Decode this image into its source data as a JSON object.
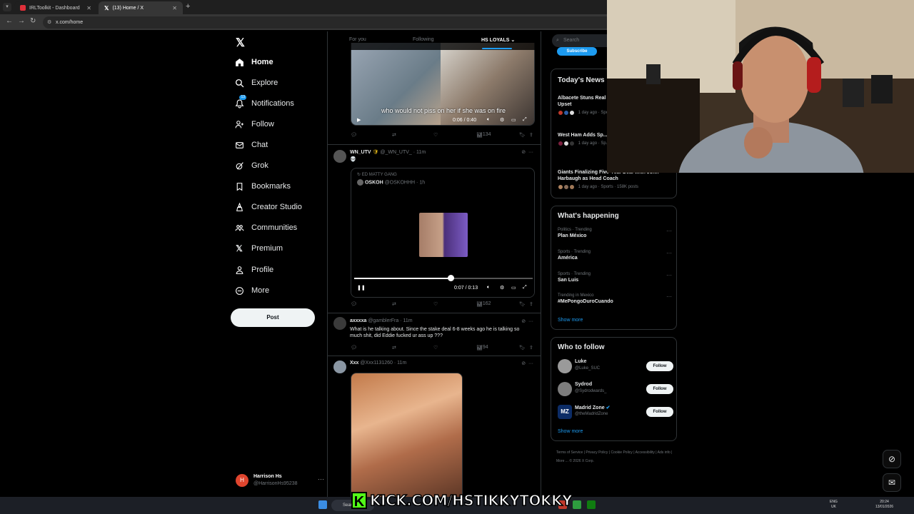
{
  "browser": {
    "tabs": [
      {
        "label": "IRLToolkit - Dashboard",
        "color": "#e0303a"
      },
      {
        "label": "(13) Home / X",
        "color": "#ffffff"
      }
    ],
    "url": "x.com/home"
  },
  "nav": {
    "items": [
      {
        "label": "Home",
        "icon": "home-icon"
      },
      {
        "label": "Explore",
        "icon": "search-icon"
      },
      {
        "label": "Notifications",
        "icon": "bell-icon",
        "badge": "13"
      },
      {
        "label": "Follow",
        "icon": "add-person-icon"
      },
      {
        "label": "Chat",
        "icon": "mail-icon"
      },
      {
        "label": "Grok",
        "icon": "grok-icon"
      },
      {
        "label": "Bookmarks",
        "icon": "bookmark-icon"
      },
      {
        "label": "Creator Studio",
        "icon": "creator-icon"
      },
      {
        "label": "Communities",
        "icon": "people-icon"
      },
      {
        "label": "Premium",
        "icon": "x-icon"
      },
      {
        "label": "Profile",
        "icon": "person-icon"
      },
      {
        "label": "More",
        "icon": "more-circle-icon"
      }
    ],
    "post_label": "Post",
    "account": {
      "name": "Harrison Hs",
      "handle": "@HarrisonHs95238",
      "initial": "H"
    }
  },
  "timeline": {
    "tabs": [
      "For you",
      "Following",
      "HS LOYALS"
    ],
    "video1": {
      "caption": "who would not piss on her if she was on fire",
      "time": "0:06 / 0:40",
      "views": "134"
    },
    "tweet2": {
      "name": "WN_UTV",
      "handle": "@_WN_UTV_",
      "time": "11m",
      "text": "💀",
      "quote_context": "ED MATTY GANG",
      "quote_name": "OSKOH",
      "quote_handle": "@OSKOHHH",
      "quote_time": "1h",
      "video_time": "0:07 / 0:13",
      "views": "162"
    },
    "tweet3": {
      "name": "axxxxa",
      "handle": "@gamblerFra",
      "time": "11m",
      "text": "What is he talking about. Since the stake deal 6-8 weeks ago he is talking so much shit, did Eddie fucked ur ass up ???",
      "views": "94"
    },
    "tweet4": {
      "name": "Xxx",
      "handle": "@Xxx1131260",
      "time": "11m"
    }
  },
  "right": {
    "search_placeholder": "Search",
    "subscribe_label": "Subscribe",
    "news": {
      "title": "Today's News",
      "items": [
        {
          "title": "Albacete Stuns Real Madrid in Copa del Rey Upset",
          "meta": "1 day ago · Sports"
        },
        {
          "title": "West Ham Adds Sp... to Nuno's Staff Ami...",
          "meta": "1 day ago · Sp..."
        },
        {
          "title": "Giants Finalizing Five-Year Deal With John Harbaugh as Head Coach",
          "meta": "1 day ago · Sports · 158K posts"
        }
      ]
    },
    "happening": {
      "title": "What's happening",
      "trends": [
        {
          "context": "Politics · Trending",
          "name": "Plan México"
        },
        {
          "context": "Sports · Trending",
          "name": "América"
        },
        {
          "context": "Sports · Trending",
          "name": "San Luis"
        },
        {
          "context": "Trending in Mexico",
          "name": "#MePongoDuroCuando"
        }
      ],
      "show_more": "Show more"
    },
    "who_to_follow": {
      "title": "Who to follow",
      "accounts": [
        {
          "name": "Luke",
          "handle": "@Luke_SUC",
          "button": "Follow"
        },
        {
          "name": "Sydrod",
          "handle": "@Sydrodwards_",
          "button": "Follow"
        },
        {
          "name": "Madrid Zone",
          "handle": "@theMadridZone",
          "button": "Follow"
        }
      ],
      "show_more": "Show more"
    },
    "footer": {
      "links": [
        "Terms of Service",
        "Privacy Policy",
        "Cookie Policy",
        "Accessibility",
        "Ads info",
        "More ...",
        "© 2026 X Corp."
      ]
    }
  },
  "taskbar": {
    "search_label": "Search",
    "lang": "ENG",
    "region": "UK",
    "time": "20:24",
    "date": "13/01/2026"
  },
  "overlay": {
    "kick_text": "KICK.COM/HSTIKKYTOKKY",
    "kick_letter": "K"
  },
  "colors": {
    "accent": "#1d9bf0",
    "kick_green": "#53fc18"
  }
}
